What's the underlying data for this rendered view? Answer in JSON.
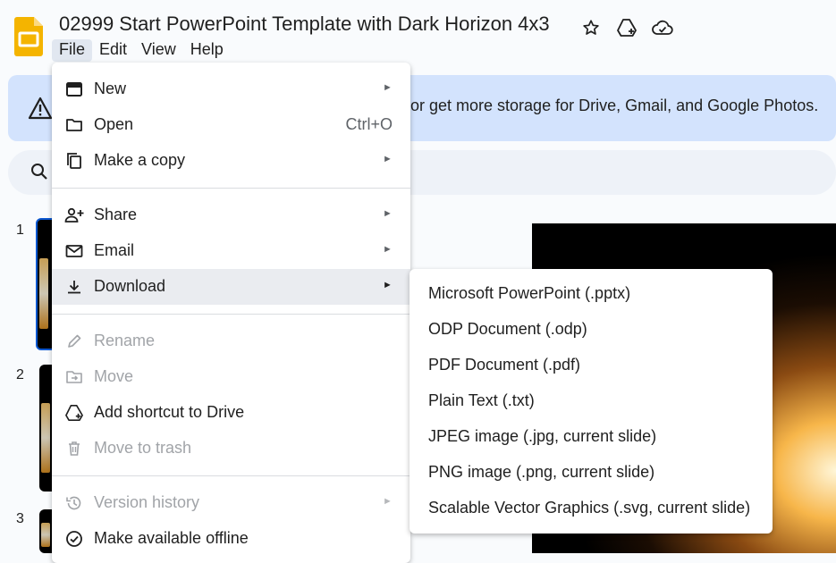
{
  "header": {
    "title": "02999 Start PowerPoint Template with Dark Horizon 4x3",
    "icons": [
      "star-icon",
      "move-to-drive-icon",
      "cloud-saved-icon"
    ],
    "accent_color": "#f4b400"
  },
  "menubar": {
    "items": [
      "File",
      "Edit",
      "View",
      "Help"
    ],
    "active": "File"
  },
  "banner": {
    "text": "or get more storage for Drive, Gmail, and Google Photos.",
    "background": "#d3e3fd"
  },
  "slides": {
    "numbers": [
      "1",
      "2",
      "3"
    ]
  },
  "file_menu": {
    "items": [
      {
        "label": "New",
        "icon": "new-presentation-icon",
        "submenu": true
      },
      {
        "label": "Open",
        "icon": "folder-icon",
        "shortcut": "Ctrl+O"
      },
      {
        "label": "Make a copy",
        "icon": "copy-icon",
        "submenu": true
      },
      {
        "label": "Share",
        "icon": "person-add-icon",
        "submenu": true
      },
      {
        "label": "Email",
        "icon": "mail-icon",
        "submenu": true
      },
      {
        "label": "Download",
        "icon": "download-icon",
        "submenu": true,
        "highlighted": true
      },
      {
        "label": "Rename",
        "icon": "pencil-icon",
        "disabled": true
      },
      {
        "label": "Move",
        "icon": "move-folder-icon",
        "disabled": true
      },
      {
        "label": "Add shortcut to Drive",
        "icon": "add-to-drive-icon"
      },
      {
        "label": "Move to trash",
        "icon": "trash-icon",
        "disabled": true
      },
      {
        "label": "Version history",
        "icon": "history-icon",
        "submenu": true,
        "disabled": true
      },
      {
        "label": "Make available offline",
        "icon": "offline-check-icon"
      }
    ],
    "arrow_glyph": "►"
  },
  "download_submenu": {
    "items": [
      "Microsoft PowerPoint (.pptx)",
      "ODP Document (.odp)",
      "PDF Document (.pdf)",
      "Plain Text (.txt)",
      "JPEG image (.jpg, current slide)",
      "PNG image (.png, current slide)",
      "Scalable Vector Graphics (.svg, current slide)"
    ]
  }
}
